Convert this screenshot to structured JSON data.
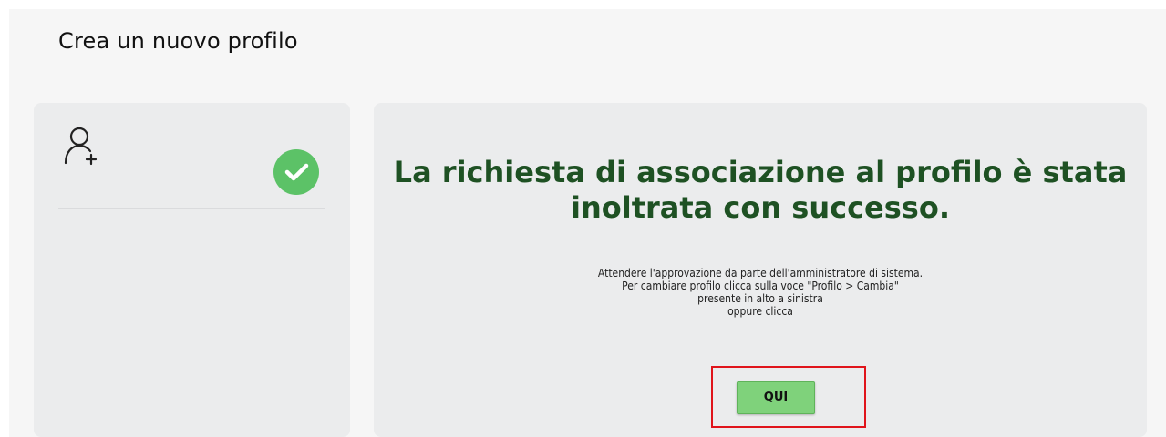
{
  "page": {
    "title": "Crea un nuovo profilo"
  },
  "side_card": {
    "user_icon": "user-add-icon",
    "status_icon": "check-circle-icon",
    "status_color": "#5cc267"
  },
  "main_card": {
    "success_title_line1": "La richiesta di associazione al profilo è stata",
    "success_title_line2": "inoltrata con successo.",
    "info_lines": [
      "Attendere l'approvazione da parte dell'amministratore di sistema.",
      "Per cambiare profilo clicca sulla voce \"Profilo > Cambia\"",
      "presente in alto a sinistra",
      "oppure clicca"
    ],
    "button_label": "QUI"
  },
  "colors": {
    "title_green": "#1e5123",
    "button_green": "#7fd27b",
    "highlight_red": "#e0141b"
  }
}
